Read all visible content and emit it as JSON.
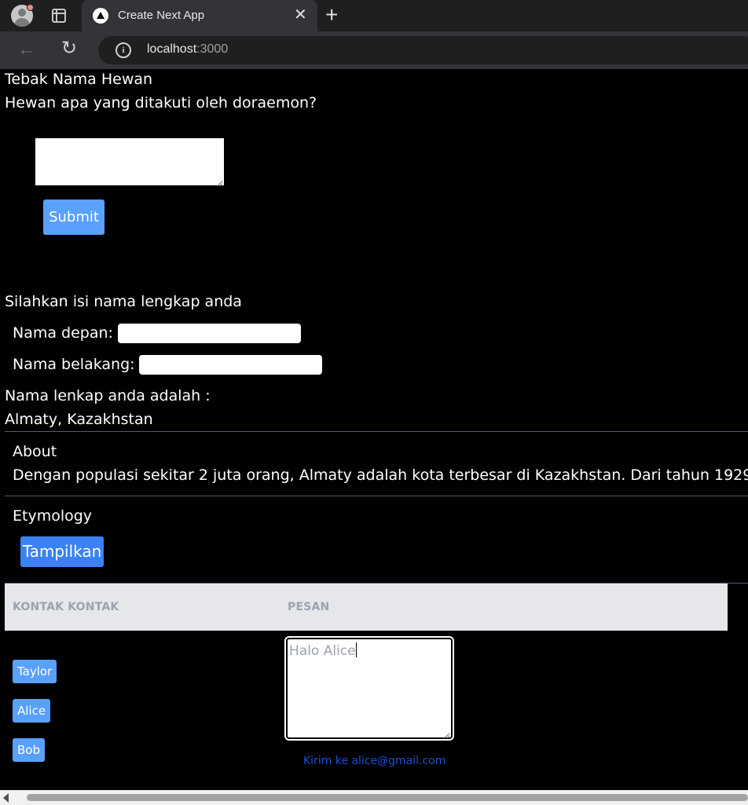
{
  "browser": {
    "tab_title": "Create Next App",
    "url_host": "localhost",
    "url_port": ":3000",
    "icons": [
      "profile-avatar-icon",
      "tab-groups-icon",
      "nextjs-favicon-icon",
      "close-icon",
      "plus-icon",
      "back-arrow-icon",
      "reload-icon",
      "info-icon"
    ],
    "glyphs": {
      "close": "✕",
      "new_tab": "+",
      "back": "←",
      "reload": "↻",
      "info": "i"
    }
  },
  "quiz": {
    "title": "Tebak Nama Hewan",
    "question": "Hewan apa yang ditakuti oleh doraemon?",
    "answer_value": "",
    "submit_label": "Submit"
  },
  "fullname": {
    "heading": "Silahkan isi nama lengkap anda",
    "first_label": "Nama depan:",
    "first_value": "",
    "last_label": "Nama belakang:",
    "last_value": "",
    "result_label": "Nama lenkap anda adalah :"
  },
  "city": {
    "name": "Almaty, Kazakhstan",
    "about_heading": "About",
    "about_text": "Dengan populasi sekitar 2 juta orang, Almaty adalah kota terbesar di Kazakhstan. Dari tahun 1929 h",
    "etymology_heading": "Etymology",
    "show_button": "Tampilkan"
  },
  "messenger": {
    "col_contacts": "KONTAK KONTAK",
    "col_message": "PESAN",
    "contacts": [
      "Taylor",
      "Alice",
      "Bob"
    ],
    "message_placeholder": "Halo Alice",
    "message_value": "",
    "send_label": "Kirim ke alice@gmail.com"
  },
  "colors": {
    "page_bg": "#000000",
    "button_blue": "#5aa0ff",
    "button_blue_strong": "#3b82f6",
    "table_header_bg": "#e5e7eb",
    "link_blue": "#1d4ed8"
  }
}
